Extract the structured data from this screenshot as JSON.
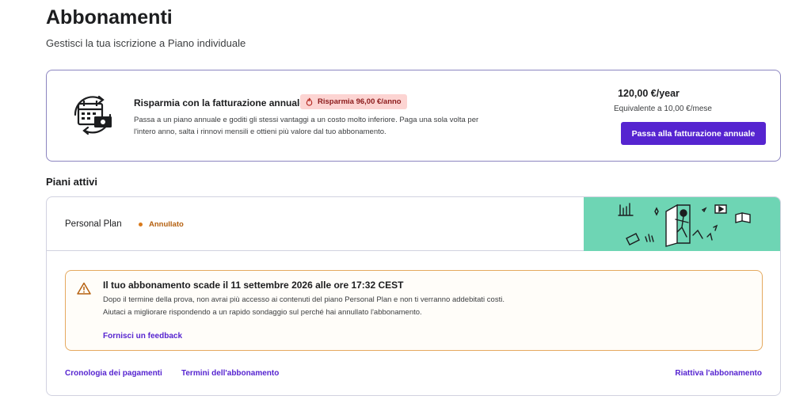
{
  "header": {
    "title": "Abbonamenti",
    "subtitle": "Gestisci la tua iscrizione a Piano individuale"
  },
  "annual_offer": {
    "title": "Risparmia con la fatturazione annuale",
    "badge": "Risparmia 96,00 €/anno",
    "description": "Passa a un piano annuale e goditi gli stessi vantaggi a un costo molto inferiore. Paga una sola volta per l'intero anno, salta i rinnovi mensili e ottieni più valore dal tuo abbonamento.",
    "price": "120,00 €/year",
    "equivalent": "Equivalente a 10,00 €/mese",
    "button_label": "Passa alla fatturazione annuale",
    "icon": "calendar-billing-icon"
  },
  "active_plans": {
    "section_title": "Piani attivi",
    "plan_name": "Personal Plan",
    "status": "Annullato",
    "status_color": "#d97a1c",
    "illustration_bg": "#6ed5b4",
    "alert": {
      "icon": "warning-icon",
      "title": "Il tuo abbonamento scade il 11 settembre 2026 alle ore 17:32 CEST",
      "line1": "Dopo il termine della prova, non avrai più accesso ai contenuti del piano Personal Plan e non ti verranno addebitati costi.",
      "line2": "Aiutaci a migliorare rispondendo a un rapido sondaggio sul perché hai annullato l'abbonamento.",
      "feedback_link": "Fornisci un feedback"
    },
    "links": {
      "payment_history": "Cronologia dei pagamenti",
      "terms": "Termini dell'abbonamento",
      "reactivate": "Riattiva l'abbonamento"
    }
  },
  "colors": {
    "accent": "#5624d0",
    "card_border": "#8c85c0",
    "alert_border": "#e5a95f",
    "badge_bg": "#fcd4d2"
  }
}
